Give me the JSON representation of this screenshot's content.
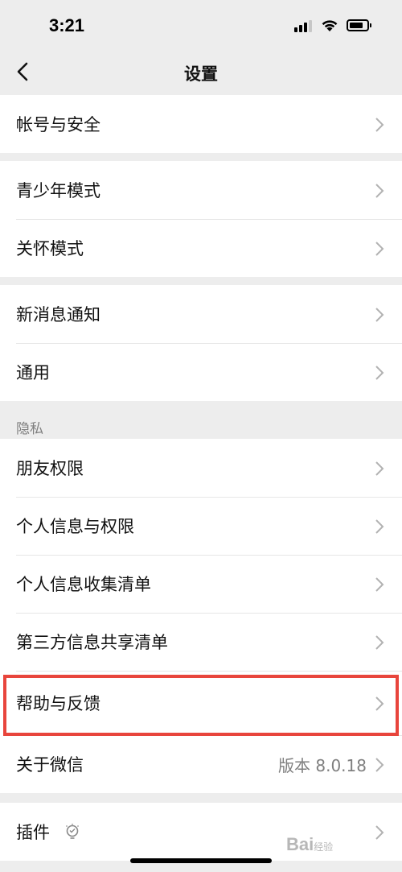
{
  "status_bar": {
    "time": "3:21",
    "battery_level": 0.8
  },
  "nav": {
    "title": "设置"
  },
  "groups": [
    {
      "rows": [
        {
          "label": "帐号与安全"
        }
      ]
    },
    {
      "rows": [
        {
          "label": "青少年模式"
        },
        {
          "label": "关怀模式"
        }
      ]
    },
    {
      "rows": [
        {
          "label": "新消息通知"
        },
        {
          "label": "通用"
        }
      ]
    },
    {
      "header": "隐私",
      "rows": [
        {
          "label": "朋友权限"
        },
        {
          "label": "个人信息与权限"
        },
        {
          "label": "个人信息收集清单"
        },
        {
          "label": "第三方信息共享清单"
        },
        {
          "label": "帮助与反馈",
          "highlighted": true
        },
        {
          "label": "关于微信",
          "value": "版本 8.0.18"
        }
      ]
    },
    {
      "rows": [
        {
          "label": "插件",
          "icon": "lightbulb-icon"
        }
      ]
    }
  ],
  "watermark": {
    "text": "Bai",
    "suffix": "经验"
  },
  "colors": {
    "highlight": "#e8453c",
    "background": "#ededed"
  }
}
